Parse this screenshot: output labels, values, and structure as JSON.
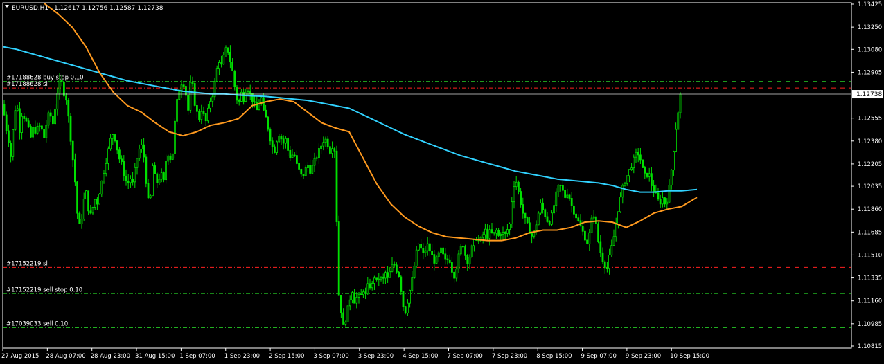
{
  "header": {
    "menu_icon": "triangle-down-icon",
    "symbol_timeframe": "EURUSD,H1",
    "ohlc": "1.12617 1.12756 1.12587 1.12738"
  },
  "current_price_label": "1.12738",
  "colors": {
    "background": "#000000",
    "frame": "#ffffff",
    "candles": "#00e000",
    "ma_fast": "#ff9a1f",
    "ma_slow": "#31d2ff",
    "sl_line": "#ff2020",
    "order_line": "#20b020",
    "labels": "#ffffff"
  },
  "order_lines": [
    {
      "label": "#17188628 buy stop 0.10",
      "price": 1.12835,
      "kind": "order"
    },
    {
      "label": "#17188628 sl",
      "price": 1.12785,
      "kind": "sl"
    },
    {
      "label": "#17152219 sl",
      "price": 1.11415,
      "kind": "sl"
    },
    {
      "label": "#17152219 sell stop 0.10",
      "price": 1.11215,
      "kind": "order"
    },
    {
      "label": "#17039033 sell 0.10",
      "price": 1.10955,
      "kind": "order"
    }
  ],
  "chart_data": {
    "type": "candlestick",
    "symbol": "EURUSD",
    "timeframe": "H1",
    "y_ticks": [
      "1.13425",
      "1.13250",
      "1.13080",
      "1.12905",
      "1.12555",
      "1.12380",
      "1.12205",
      "1.12035",
      "1.11860",
      "1.11685",
      "1.11510",
      "1.11335",
      "1.11160",
      "1.10985",
      "1.10815"
    ],
    "ylim": [
      1.10815,
      1.13425
    ],
    "x_ticks": [
      "27 Aug 2015",
      "28 Aug 07:00",
      "28 Aug 23:00",
      "31 Aug 15:00",
      "1 Sep 07:00",
      "1 Sep 23:00",
      "2 Sep 15:00",
      "3 Sep 07:00",
      "3 Sep 23:00",
      "4 Sep 15:00",
      "7 Sep 07:00",
      "7 Sep 23:00",
      "8 Sep 15:00",
      "9 Sep 07:00",
      "9 Sep 23:00",
      "10 Sep 15:00"
    ],
    "close_path": [
      [
        0,
        1.1266
      ],
      [
        4,
        1.125
      ],
      [
        8,
        1.124
      ],
      [
        12,
        1.1225
      ],
      [
        16,
        1.1255
      ],
      [
        20,
        1.127
      ],
      [
        24,
        1.1245
      ],
      [
        28,
        1.126
      ],
      [
        32,
        1.1255
      ],
      [
        36,
        1.125
      ],
      [
        40,
        1.124
      ],
      [
        44,
        1.1248
      ],
      [
        48,
        1.1245
      ],
      [
        52,
        1.125
      ],
      [
        56,
        1.1247
      ],
      [
        60,
        1.124
      ],
      [
        64,
        1.1255
      ],
      [
        68,
        1.126
      ],
      [
        72,
        1.125
      ],
      [
        76,
        1.1265
      ],
      [
        80,
        1.128
      ],
      [
        84,
        1.1285
      ],
      [
        88,
        1.1275
      ],
      [
        92,
        1.127
      ],
      [
        96,
        1.125
      ],
      [
        100,
        1.123
      ],
      [
        104,
        1.121
      ],
      [
        108,
        1.118
      ],
      [
        112,
        1.117
      ],
      [
        116,
        1.119
      ],
      [
        120,
        1.12
      ],
      [
        124,
        1.1185
      ],
      [
        128,
        1.118
      ],
      [
        132,
        1.1195
      ],
      [
        136,
        1.119
      ],
      [
        140,
        1.12
      ],
      [
        144,
        1.121
      ],
      [
        148,
        1.122
      ],
      [
        152,
        1.123
      ],
      [
        156,
        1.124
      ],
      [
        160,
        1.1245
      ],
      [
        164,
        1.1235
      ],
      [
        168,
        1.1225
      ],
      [
        172,
        1.122
      ],
      [
        176,
        1.121
      ],
      [
        180,
        1.1205
      ],
      [
        184,
        1.121
      ],
      [
        188,
        1.1205
      ],
      [
        192,
        1.122
      ],
      [
        196,
        1.123
      ],
      [
        200,
        1.1235
      ],
      [
        204,
        1.1225
      ],
      [
        208,
        1.12
      ],
      [
        212,
        1.1185
      ],
      [
        216,
        1.122
      ],
      [
        220,
        1.121
      ],
      [
        224,
        1.1205
      ],
      [
        228,
        1.1215
      ],
      [
        232,
        1.1205
      ],
      [
        236,
        1.1225
      ],
      [
        240,
        1.123
      ],
      [
        244,
        1.122
      ],
      [
        248,
        1.125
      ],
      [
        252,
        1.127
      ],
      [
        256,
        1.128
      ],
      [
        260,
        1.1285
      ],
      [
        264,
        1.1275
      ],
      [
        268,
        1.126
      ],
      [
        272,
        1.129
      ],
      [
        276,
        1.127
      ],
      [
        280,
        1.126
      ],
      [
        284,
        1.1255
      ],
      [
        288,
        1.1265
      ],
      [
        292,
        1.125
      ],
      [
        296,
        1.126
      ],
      [
        300,
        1.127
      ],
      [
        304,
        1.1275
      ],
      [
        308,
        1.129
      ],
      [
        312,
        1.13
      ],
      [
        316,
        1.1295
      ],
      [
        320,
        1.1305
      ],
      [
        324,
        1.131
      ],
      [
        328,
        1.13
      ],
      [
        332,
        1.129
      ],
      [
        336,
        1.1275
      ],
      [
        340,
        1.1265
      ],
      [
        344,
        1.1275
      ],
      [
        348,
        1.127
      ],
      [
        352,
        1.128
      ],
      [
        356,
        1.1275
      ],
      [
        360,
        1.127
      ],
      [
        364,
        1.1265
      ],
      [
        368,
        1.126
      ],
      [
        372,
        1.1275
      ],
      [
        376,
        1.126
      ],
      [
        380,
        1.1255
      ],
      [
        384,
        1.1245
      ],
      [
        388,
        1.1235
      ],
      [
        392,
        1.123
      ],
      [
        396,
        1.124
      ],
      [
        400,
        1.1245
      ],
      [
        404,
        1.1235
      ],
      [
        408,
        1.124
      ],
      [
        412,
        1.123
      ],
      [
        416,
        1.1225
      ],
      [
        420,
        1.123
      ],
      [
        424,
        1.122
      ],
      [
        428,
        1.1215
      ],
      [
        432,
        1.121
      ],
      [
        436,
        1.1215
      ],
      [
        440,
        1.122
      ],
      [
        444,
        1.1215
      ],
      [
        448,
        1.122
      ],
      [
        452,
        1.1225
      ],
      [
        456,
        1.123
      ],
      [
        460,
        1.1235
      ],
      [
        464,
        1.124
      ],
      [
        468,
        1.1238
      ],
      [
        472,
        1.123
      ],
      [
        476,
        1.1235
      ],
      [
        480,
        1.123
      ],
      [
        484,
        1.1125
      ],
      [
        488,
        1.111
      ],
      [
        492,
        1.1095
      ],
      [
        496,
        1.1105
      ],
      [
        500,
        1.1115
      ],
      [
        504,
        1.1125
      ],
      [
        508,
        1.1115
      ],
      [
        512,
        1.112
      ],
      [
        516,
        1.1118
      ],
      [
        520,
        1.1125
      ],
      [
        524,
        1.112
      ],
      [
        528,
        1.113
      ],
      [
        532,
        1.1125
      ],
      [
        536,
        1.1135
      ],
      [
        540,
        1.113
      ],
      [
        544,
        1.1135
      ],
      [
        548,
        1.113
      ],
      [
        552,
        1.1138
      ],
      [
        556,
        1.1132
      ],
      [
        560,
        1.114
      ],
      [
        564,
        1.1145
      ],
      [
        568,
        1.114
      ],
      [
        572,
        1.1135
      ],
      [
        576,
        1.112
      ],
      [
        580,
        1.1105
      ],
      [
        584,
        1.1115
      ],
      [
        588,
        1.1125
      ],
      [
        592,
        1.1135
      ],
      [
        596,
        1.115
      ],
      [
        600,
        1.116
      ],
      [
        604,
        1.1155
      ],
      [
        608,
        1.115
      ],
      [
        612,
        1.116
      ],
      [
        616,
        1.1155
      ],
      [
        620,
        1.115
      ],
      [
        624,
        1.1145
      ],
      [
        628,
        1.115
      ],
      [
        632,
        1.1155
      ],
      [
        636,
        1.115
      ],
      [
        640,
        1.1145
      ],
      [
        644,
        1.115
      ],
      [
        648,
        1.114
      ],
      [
        652,
        1.1135
      ],
      [
        656,
        1.1145
      ],
      [
        660,
        1.1155
      ],
      [
        664,
        1.116
      ],
      [
        668,
        1.115
      ],
      [
        672,
        1.1145
      ],
      [
        676,
        1.1155
      ],
      [
        680,
        1.116
      ],
      [
        684,
        1.1165
      ],
      [
        688,
        1.116
      ],
      [
        692,
        1.1165
      ],
      [
        696,
        1.117
      ],
      [
        700,
        1.1165
      ],
      [
        704,
        1.117
      ],
      [
        708,
        1.1165
      ],
      [
        712,
        1.117
      ],
      [
        716,
        1.1165
      ],
      [
        720,
        1.117
      ],
      [
        724,
        1.1165
      ],
      [
        728,
        1.117
      ],
      [
        732,
        1.1175
      ],
      [
        736,
        1.12
      ],
      [
        740,
        1.121
      ],
      [
        744,
        1.12
      ],
      [
        748,
        1.119
      ],
      [
        752,
        1.118
      ],
      [
        756,
        1.1175
      ],
      [
        760,
        1.117
      ],
      [
        764,
        1.1165
      ],
      [
        768,
        1.117
      ],
      [
        772,
        1.118
      ],
      [
        776,
        1.119
      ],
      [
        780,
        1.1185
      ],
      [
        784,
        1.118
      ],
      [
        788,
        1.1175
      ],
      [
        792,
        1.118
      ],
      [
        796,
        1.119
      ],
      [
        800,
        1.12
      ],
      [
        804,
        1.1205
      ],
      [
        808,
        1.12
      ],
      [
        812,
        1.1195
      ],
      [
        816,
        1.12
      ],
      [
        820,
        1.119
      ],
      [
        824,
        1.1185
      ],
      [
        828,
        1.118
      ],
      [
        832,
        1.1175
      ],
      [
        836,
        1.117
      ],
      [
        840,
        1.1165
      ],
      [
        844,
        1.116
      ],
      [
        848,
        1.117
      ],
      [
        852,
        1.1185
      ],
      [
        856,
        1.1175
      ],
      [
        860,
        1.116
      ],
      [
        864,
        1.115
      ],
      [
        868,
        1.1145
      ],
      [
        872,
        1.114
      ],
      [
        876,
        1.115
      ],
      [
        880,
        1.116
      ],
      [
        884,
        1.117
      ],
      [
        888,
        1.1185
      ],
      [
        892,
        1.1195
      ],
      [
        896,
        1.1205
      ],
      [
        900,
        1.121
      ],
      [
        904,
        1.1215
      ],
      [
        908,
        1.122
      ],
      [
        912,
        1.1225
      ],
      [
        916,
        1.123
      ],
      [
        920,
        1.1225
      ],
      [
        924,
        1.1215
      ],
      [
        928,
        1.121
      ],
      [
        932,
        1.1215
      ],
      [
        936,
        1.1205
      ],
      [
        940,
        1.12
      ],
      [
        944,
        1.1195
      ],
      [
        948,
        1.119
      ],
      [
        952,
        1.1195
      ],
      [
        956,
        1.119
      ],
      [
        960,
        1.1195
      ],
      [
        964,
        1.121
      ],
      [
        968,
        1.123
      ],
      [
        972,
        1.125
      ],
      [
        976,
        1.1265
      ],
      [
        980,
        1.12738
      ]
    ],
    "ma_fast": {
      "name": "MA fast",
      "points": [
        [
          60,
          1.1345
        ],
        [
          80,
          1.1335
        ],
        [
          100,
          1.1325
        ],
        [
          120,
          1.131
        ],
        [
          140,
          1.129
        ],
        [
          160,
          1.1275
        ],
        [
          180,
          1.1265
        ],
        [
          200,
          1.126
        ],
        [
          220,
          1.1252
        ],
        [
          240,
          1.1245
        ],
        [
          260,
          1.1242
        ],
        [
          280,
          1.1245
        ],
        [
          300,
          1.125
        ],
        [
          320,
          1.1252
        ],
        [
          340,
          1.1255
        ],
        [
          360,
          1.1265
        ],
        [
          380,
          1.1268
        ],
        [
          400,
          1.127
        ],
        [
          420,
          1.1268
        ],
        [
          440,
          1.126
        ],
        [
          460,
          1.1252
        ],
        [
          480,
          1.1248
        ],
        [
          500,
          1.1245
        ],
        [
          520,
          1.1225
        ],
        [
          540,
          1.1205
        ],
        [
          560,
          1.119
        ],
        [
          580,
          1.118
        ],
        [
          600,
          1.1173
        ],
        [
          620,
          1.1168
        ],
        [
          640,
          1.1165
        ],
        [
          660,
          1.1164
        ],
        [
          680,
          1.1163
        ],
        [
          700,
          1.1162
        ],
        [
          720,
          1.1162
        ],
        [
          740,
          1.1164
        ],
        [
          760,
          1.1168
        ],
        [
          780,
          1.117
        ],
        [
          800,
          1.117
        ],
        [
          820,
          1.1172
        ],
        [
          840,
          1.1176
        ],
        [
          860,
          1.1177
        ],
        [
          880,
          1.1176
        ],
        [
          900,
          1.1172
        ],
        [
          920,
          1.1177
        ],
        [
          940,
          1.1183
        ],
        [
          960,
          1.1186
        ],
        [
          980,
          1.1188
        ],
        [
          1002,
          1.1195
        ]
      ]
    },
    "ma_slow": {
      "name": "MA slow",
      "points": [
        [
          0,
          1.131
        ],
        [
          20,
          1.1308
        ],
        [
          40,
          1.1305
        ],
        [
          60,
          1.1302
        ],
        [
          80,
          1.1299
        ],
        [
          100,
          1.1296
        ],
        [
          120,
          1.1293
        ],
        [
          140,
          1.129
        ],
        [
          160,
          1.1287
        ],
        [
          180,
          1.1284
        ],
        [
          200,
          1.1282
        ],
        [
          220,
          1.128
        ],
        [
          240,
          1.1278
        ],
        [
          260,
          1.1276
        ],
        [
          280,
          1.1275
        ],
        [
          300,
          1.1274
        ],
        [
          320,
          1.1274
        ],
        [
          340,
          1.1273
        ],
        [
          360,
          1.12725
        ],
        [
          380,
          1.1272
        ],
        [
          400,
          1.1271
        ],
        [
          420,
          1.127
        ],
        [
          440,
          1.1269
        ],
        [
          460,
          1.1267
        ],
        [
          480,
          1.1265
        ],
        [
          500,
          1.1263
        ],
        [
          520,
          1.1258
        ],
        [
          540,
          1.1253
        ],
        [
          560,
          1.1248
        ],
        [
          580,
          1.1243
        ],
        [
          600,
          1.1239
        ],
        [
          620,
          1.1235
        ],
        [
          640,
          1.1231
        ],
        [
          660,
          1.1227
        ],
        [
          680,
          1.1224
        ],
        [
          700,
          1.1221
        ],
        [
          720,
          1.1218
        ],
        [
          740,
          1.1215
        ],
        [
          760,
          1.1213
        ],
        [
          780,
          1.1211
        ],
        [
          800,
          1.1209
        ],
        [
          820,
          1.1208
        ],
        [
          840,
          1.1207
        ],
        [
          860,
          1.1206
        ],
        [
          880,
          1.1204
        ],
        [
          900,
          1.1201
        ],
        [
          920,
          1.1199
        ],
        [
          940,
          1.1199
        ],
        [
          960,
          1.12
        ],
        [
          980,
          1.12
        ],
        [
          1002,
          1.1201
        ]
      ]
    }
  }
}
